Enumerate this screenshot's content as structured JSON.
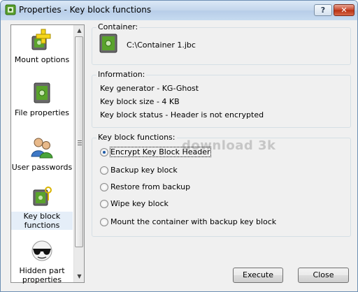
{
  "window": {
    "title": "Properties - Key block functions",
    "help_label": "?",
    "close_label": "✕"
  },
  "sidebar": {
    "items": [
      {
        "label": "Mount options",
        "icon": "mount-plus-icon"
      },
      {
        "label": "File properties",
        "icon": "safe-file-icon"
      },
      {
        "label": "User passwords",
        "icon": "users-icon"
      },
      {
        "label": "Key block functions",
        "icon": "key-safe-icon",
        "selected": true
      },
      {
        "label": "Hidden part properties",
        "icon": "sunglasses-icon"
      }
    ]
  },
  "container": {
    "label": "Container:",
    "path": "C:\\Container 1.jbc"
  },
  "information": {
    "label": "Information:",
    "lines": [
      "Key generator - KG-Ghost",
      "Key block size - 4 KB",
      "Key block status - Header is not encrypted"
    ]
  },
  "key_functions": {
    "label": "Key block functions:",
    "options": [
      {
        "label": "Encrypt Key Block Header",
        "checked": true
      },
      {
        "label": "Backup key block",
        "checked": false
      },
      {
        "label": "Restore from backup",
        "checked": false
      },
      {
        "label": "Wipe key block",
        "checked": false
      },
      {
        "label": "Mount the container with backup key block",
        "checked": false
      }
    ]
  },
  "watermark": "download 3k",
  "buttons": {
    "execute": "Execute",
    "close": "Close"
  },
  "colors": {
    "accent": "#1d5aa8",
    "titlebar": "#c3d6ec",
    "close_red": "#c8452a"
  }
}
